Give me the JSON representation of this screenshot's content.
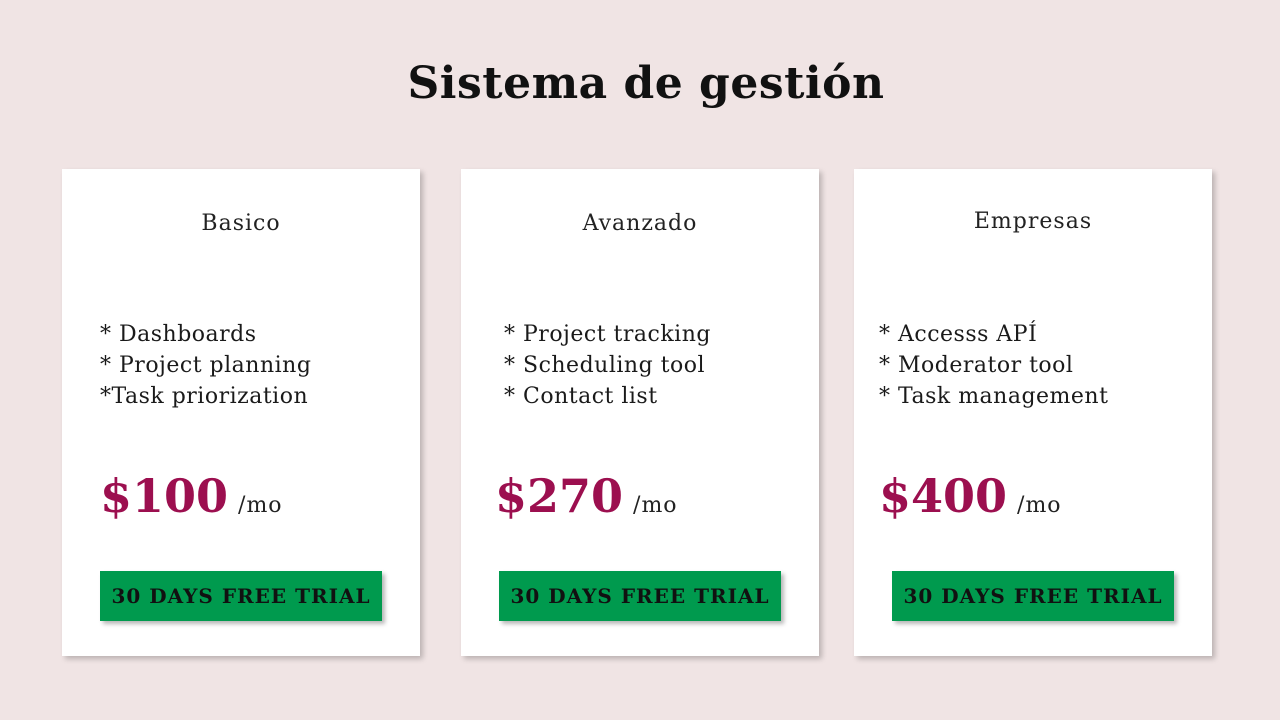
{
  "title": "Sistema de gestión",
  "colors": {
    "background": "#f0e4e4",
    "card": "#ffffff",
    "price": "#9c0f4f",
    "button": "#009a4e"
  },
  "plans": [
    {
      "name": "Basico",
      "features": [
        "* Dashboards",
        "* Project planning",
        "*Task priorization"
      ],
      "price": "$100",
      "period": "/mo",
      "cta": "30 DAYS FREE TRIAL"
    },
    {
      "name": "Avanzado",
      "features": [
        "* Project tracking",
        "* Scheduling tool",
        "* Contact list"
      ],
      "price": "$270",
      "period": "/mo",
      "cta": "30 DAYS FREE TRIAL"
    },
    {
      "name": "Empresas",
      "features": [
        "* Accesss APÍ",
        "* Moderator tool",
        "* Task management"
      ],
      "price": "$400",
      "period": "/mo",
      "cta": "30 DAYS FREE TRIAL"
    }
  ]
}
